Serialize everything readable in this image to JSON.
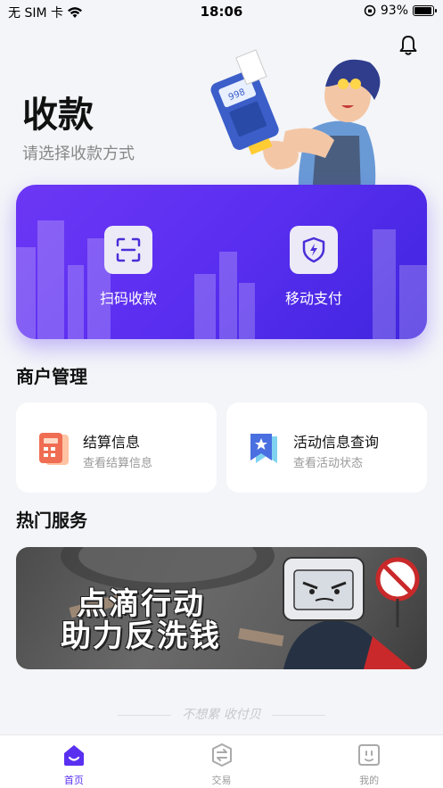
{
  "status_bar": {
    "carrier": "无 SIM 卡",
    "time": "18:06",
    "battery": "93%",
    "battery_level": 0.93
  },
  "hero": {
    "title": "收款",
    "subtitle": "请选择收款方式",
    "machine_text": "998"
  },
  "payment": {
    "scan_label": "扫码收款",
    "mobile_label": "移动支付"
  },
  "merchant": {
    "title": "商户管理",
    "settlement": {
      "title": "结算信息",
      "subtitle": "查看结算信息"
    },
    "activity": {
      "title": "活动信息查询",
      "subtitle": "查看活动状态"
    }
  },
  "hot": {
    "title": "热门服务",
    "banner_line1": "点滴行动",
    "banner_line2": "助力反洗钱"
  },
  "slogan": "不想累 收付贝",
  "tabs": [
    {
      "label": "首页",
      "icon": "home-icon",
      "active": true
    },
    {
      "label": "交易",
      "icon": "exchange-icon",
      "active": false
    },
    {
      "label": "我的",
      "icon": "profile-icon",
      "active": false
    }
  ],
  "colors": {
    "accent": "#5a30f0",
    "card_purple": "#6c37f5"
  }
}
